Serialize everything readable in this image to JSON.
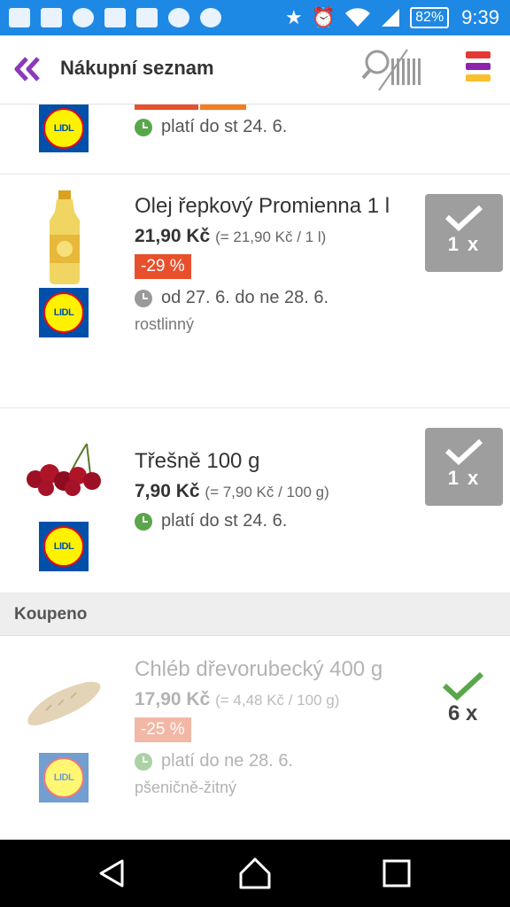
{
  "status_bar": {
    "battery": "82%",
    "time": "9:39",
    "icons": [
      "chat-icon",
      "facebook-icon",
      "add-contact-icon",
      "mail-icon",
      "photo-icon",
      "download-icon",
      "weather-icon",
      "star-icon",
      "alarm-icon",
      "wifi-icon",
      "signal-icon"
    ]
  },
  "app_bar": {
    "title": "Nákupní seznam",
    "back_icon": "double-chevron-left-icon",
    "scan_icon": "barcode-search-icon",
    "menu_icon": "menu-icon",
    "accent_color": "#8a3ab9",
    "menu_colors": [
      "#e53935",
      "#8e24aa",
      "#fbc02d"
    ]
  },
  "list": {
    "items": [
      {
        "store": "LIDL",
        "validity": "platí do st 24. 6.",
        "validity_status": "active"
      },
      {
        "name": "Olej řepkový Promienna 1 l",
        "store": "LIDL",
        "price": "21,90 Kč",
        "unit_price": "(= 21,90 Kč / 1 l)",
        "discount": "-29 %",
        "validity": "od 27. 6. do ne 28. 6.",
        "validity_status": "upcoming",
        "note": "rostlinný",
        "quantity": "1 x"
      },
      {
        "name": "Třešně 100 g",
        "store": "LIDL",
        "price": "7,90 Kč",
        "unit_price": "(= 7,90 Kč / 100 g)",
        "validity": "platí do st 24. 6.",
        "validity_status": "active",
        "quantity": "1 x"
      }
    ],
    "bought_section": {
      "title": "Koupeno",
      "items": [
        {
          "name": "Chléb dřevorubecký 400 g",
          "store": "LIDL",
          "price": "17,90 Kč",
          "unit_price": "(= 4,48 Kč / 100 g)",
          "discount": "-25 %",
          "validity": "platí do ne 28. 6.",
          "validity_status": "active",
          "note": "pšeničně-žitný",
          "quantity": "6 x"
        }
      ]
    }
  },
  "nav_bar": {
    "buttons": [
      "back-icon",
      "home-icon",
      "recents-icon"
    ]
  },
  "colors": {
    "status_bar": "#1e88e5",
    "discount": "#e8502c",
    "clock_active": "#5aa64b",
    "clock_upcoming": "#9a9a9a",
    "check_bought": "#5aa64b"
  }
}
